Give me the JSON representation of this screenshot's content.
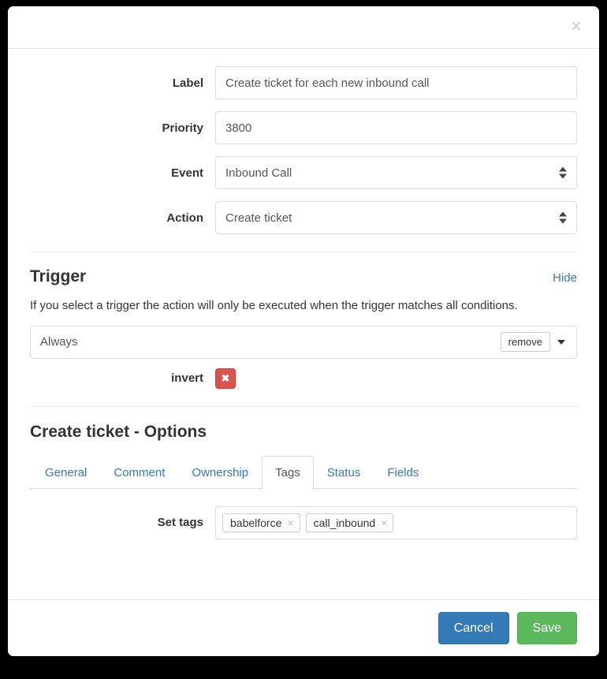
{
  "modal": {
    "close_icon": "close-icon",
    "close_glyph": "×"
  },
  "form": {
    "fields": [
      {
        "label": "Label",
        "value": "Create ticket for each new inbound call",
        "type": "text"
      },
      {
        "label": "Priority",
        "value": "3800",
        "type": "text"
      },
      {
        "label": "Event",
        "value": "Inbound Call",
        "type": "select"
      },
      {
        "label": "Action",
        "value": "Create ticket",
        "type": "select"
      }
    ]
  },
  "trigger": {
    "title": "Trigger",
    "toggle_label": "Hide",
    "description": "If you select a trigger the action will only be executed when the trigger matches all conditions.",
    "condition_value": "Always",
    "remove_label": "remove",
    "caret_icon": "chevron-down-icon",
    "invert_label": "invert",
    "invert_button_glyph": "✖"
  },
  "options": {
    "title": "Create ticket - Options",
    "tabs": [
      {
        "label": "General",
        "active": false
      },
      {
        "label": "Comment",
        "active": false
      },
      {
        "label": "Ownership",
        "active": false
      },
      {
        "label": "Tags",
        "active": true
      },
      {
        "label": "Status",
        "active": false
      },
      {
        "label": "Fields",
        "active": false
      }
    ],
    "tags_panel": {
      "label": "Set tags",
      "tags": [
        "babelforce",
        "call_inbound"
      ],
      "tag_remove_glyph": "×"
    }
  },
  "footer": {
    "cancel_label": "Cancel",
    "save_label": "Save"
  },
  "colors": {
    "primary": "#337ab7",
    "success": "#5cb85c",
    "danger": "#d9534f",
    "link": "#337ab7",
    "border": "#dddddd"
  }
}
